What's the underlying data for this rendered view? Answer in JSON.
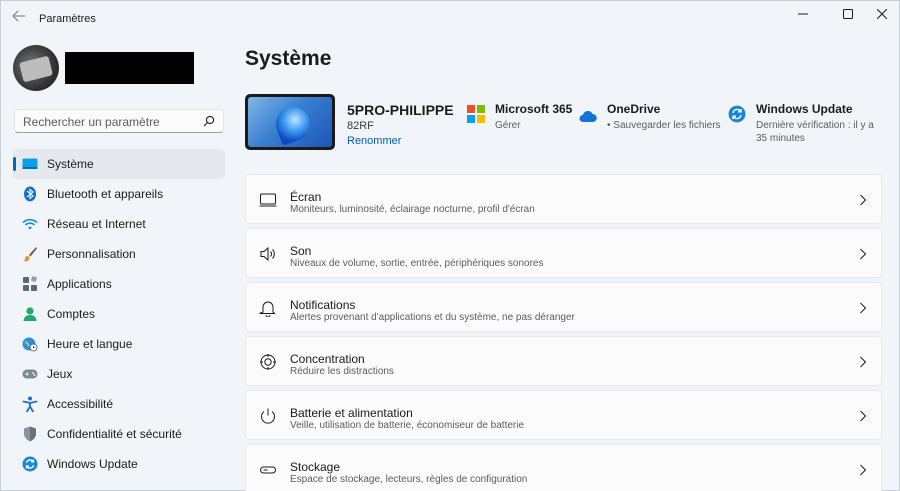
{
  "window": {
    "title": "Paramètres"
  },
  "search": {
    "placeholder": "Rechercher un paramètre"
  },
  "sidebar": {
    "items": [
      {
        "label": "Système",
        "icon": "display-icon",
        "active": true
      },
      {
        "label": "Bluetooth et appareils",
        "icon": "bluetooth-icon"
      },
      {
        "label": "Réseau et Internet",
        "icon": "wifi-icon"
      },
      {
        "label": "Personnalisation",
        "icon": "brush-icon"
      },
      {
        "label": "Applications",
        "icon": "apps-icon"
      },
      {
        "label": "Comptes",
        "icon": "person-icon"
      },
      {
        "label": "Heure et langue",
        "icon": "globe-clock-icon"
      },
      {
        "label": "Jeux",
        "icon": "gamepad-icon"
      },
      {
        "label": "Accessibilité",
        "icon": "accessibility-icon"
      },
      {
        "label": "Confidentialité et sécurité",
        "icon": "shield-icon"
      },
      {
        "label": "Windows Update",
        "icon": "update-icon"
      }
    ]
  },
  "main": {
    "title": "Système",
    "device": {
      "name": "5PRO-PHILIPPE",
      "model": "82RF",
      "rename_label": "Renommer"
    },
    "quick": [
      {
        "title": "Microsoft 365",
        "subtitle": "Gérer",
        "icon": "microsoft-logo-icon"
      },
      {
        "title": "OneDrive",
        "subtitle": "• Sauvegarder les fichiers",
        "icon": "cloud-icon"
      },
      {
        "title": "Windows Update",
        "subtitle": "Dernière vérification : il y a 35 minutes",
        "icon": "update-icon"
      }
    ],
    "cards": [
      {
        "title": "Écran",
        "desc": "Moniteurs, luminosité, éclairage nocturne, profil d'écran",
        "icon": "monitor-icon"
      },
      {
        "title": "Son",
        "desc": "Niveaux de volume, sortie, entrée, périphériques sonores",
        "icon": "speaker-icon"
      },
      {
        "title": "Notifications",
        "desc": "Alertes provenant d'applications et du système, ne pas déranger",
        "icon": "bell-icon"
      },
      {
        "title": "Concentration",
        "desc": "Réduire les distractions",
        "icon": "focus-icon"
      },
      {
        "title": "Batterie et alimentation",
        "desc": "Veille, utilisation de batterie, économiseur de batterie",
        "icon": "power-icon"
      },
      {
        "title": "Stockage",
        "desc": "Espace de stockage, lecteurs, règles de configuration",
        "icon": "storage-icon"
      }
    ]
  },
  "colors": {
    "accent": "#0067c0",
    "background": "#f1f4f8",
    "card": "#fbfbfb"
  }
}
